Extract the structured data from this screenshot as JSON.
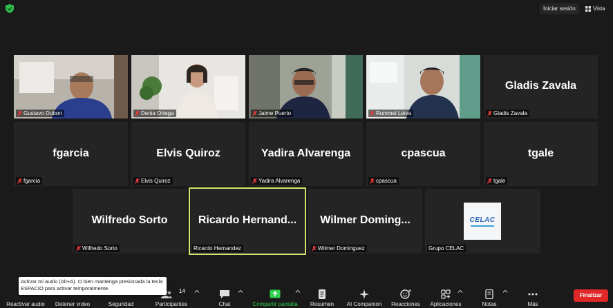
{
  "topbar": {
    "signin_label": "Iniciar sesión",
    "view_label": "Vista"
  },
  "tiles": [
    {
      "name": "Gustavo Dubon",
      "video": true,
      "muted": true
    },
    {
      "name": "Denia Ortega",
      "video": true,
      "muted": true
    },
    {
      "name": "Jaime Puerto",
      "video": true,
      "muted": true
    },
    {
      "name": "Rummel Leiva",
      "video": true,
      "muted": true
    },
    {
      "display": "Gladis Zavala",
      "name": "Gladis Zavala",
      "muted": true
    },
    {
      "display": "fgarcia",
      "name": "fgarcia",
      "muted": true
    },
    {
      "display": "Elvis Quiroz",
      "name": "Elvis Quiroz",
      "muted": true
    },
    {
      "display": "Yadira Alvarenga",
      "name": "Yadira Alvarenga",
      "muted": true
    },
    {
      "display": "cpascua",
      "name": "cpascua",
      "muted": true
    },
    {
      "display": "tgale",
      "name": "tgale",
      "muted": true
    },
    {
      "display": "Wilfredo Sorto",
      "name": "Wilfredo Sorto",
      "muted": true
    },
    {
      "display": "Ricardo  Hernand...",
      "name": "Ricardo Hernandez",
      "muted": false,
      "active": true
    },
    {
      "display": "Wilmer  Doming...",
      "name": "Wilmer Dominguez",
      "muted": true
    },
    {
      "logo_text": "CELAC",
      "name": "Grupo CELAC",
      "muted": false
    }
  ],
  "tooltip": {
    "text": "Activar mi audio (Alt+A). O bien mantenga presionada la tecla ESPACIO para activar temporalmente."
  },
  "toolbar": {
    "unmute_label": "Reactivar audio",
    "stop_video_label": "Detener vídeo",
    "security_label": "Seguridad",
    "participants_label": "Participantes",
    "participants_count": "14",
    "chat_label": "Chat",
    "share_label": "Compartir pantalla",
    "summary_label": "Resumen",
    "companion_label": "AI Companion",
    "reactions_label": "Reacciones",
    "apps_label": "Aplicaciones",
    "notes_label": "Notas",
    "more_label": "Más",
    "end_label": "Finalizar"
  },
  "colors": {
    "active_speaker": "#d9e36b",
    "muted_icon": "#e0383b",
    "share_green": "#2fd14d",
    "end_red": "#e02828",
    "shield_green": "#2fbf4a"
  }
}
